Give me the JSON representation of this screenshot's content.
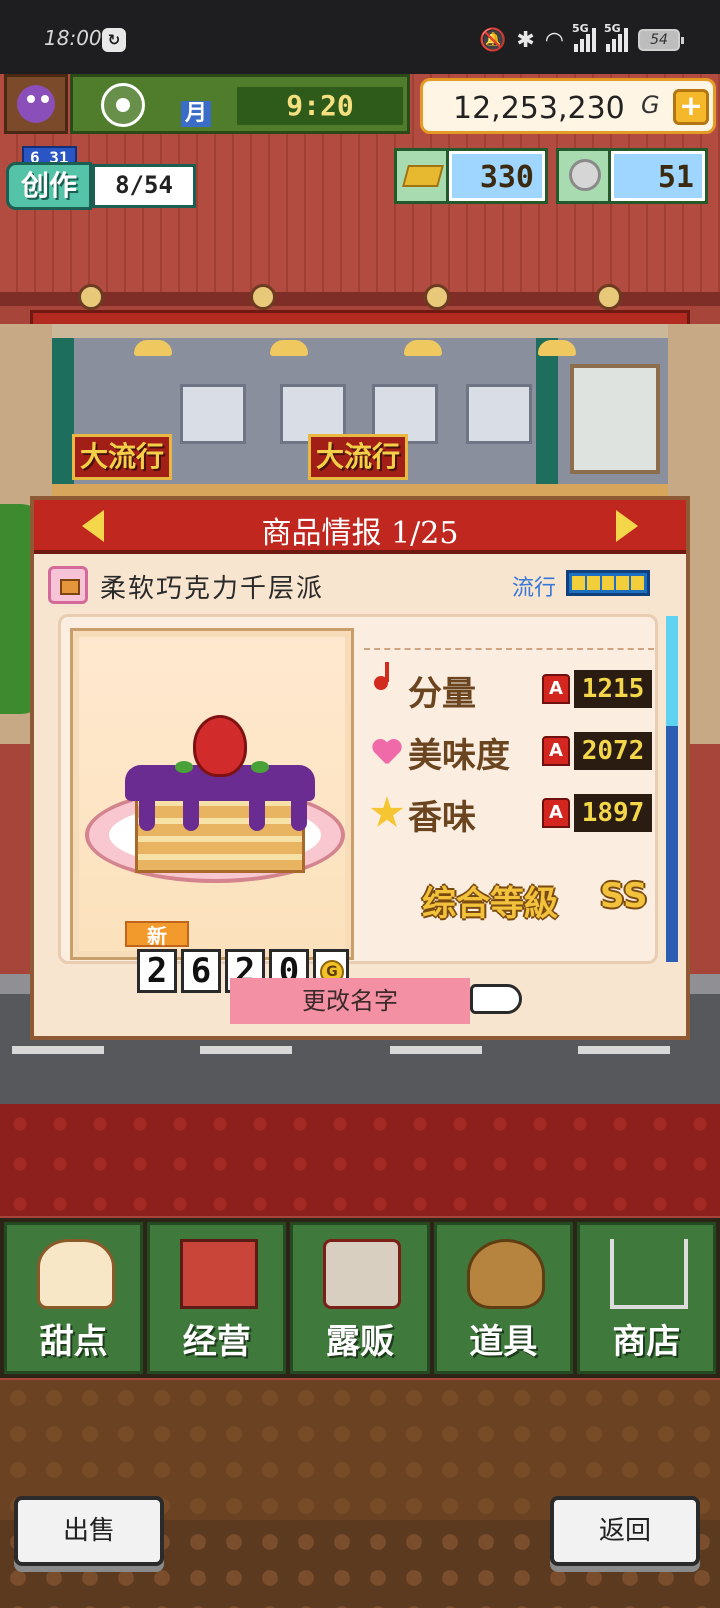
{
  "status_bar": {
    "time": "18:00",
    "battery": "54",
    "network_labels": [
      "5G",
      "5G"
    ]
  },
  "hud": {
    "month_label": "月",
    "time": "9:20",
    "gold_amount": "12,253,230",
    "gold_unit": "G",
    "plus_label": "+",
    "date": "6 31",
    "create_label": "创作",
    "create_count": "8/54",
    "resource_gold_bars": "330",
    "resource_medals": "51"
  },
  "shop": {
    "banner_left": "大流行",
    "banner_right": "大流行"
  },
  "dialog": {
    "title": "商品情报",
    "page": "1/25",
    "product_name": "柔软巧克力千层派",
    "trend_label": "流行",
    "trend_level": 5,
    "new_tag": "新",
    "price_digits": [
      "2",
      "6",
      "2",
      "0"
    ],
    "price_unit": "G",
    "stats": [
      {
        "icon": "music-note-icon",
        "label": "分量",
        "rank": "A",
        "value": "1215"
      },
      {
        "icon": "heart-icon",
        "label": "美味度",
        "rank": "A",
        "value": "2072"
      },
      {
        "icon": "star-icon",
        "label": "香味",
        "rank": "A",
        "value": "1897"
      }
    ],
    "overall_label": "综合等級",
    "overall_grade": "SS",
    "rename_label": "更改名字"
  },
  "menu": {
    "items": [
      {
        "label": "甜点",
        "icon": "cake-icon"
      },
      {
        "label": "经营",
        "icon": "shop-icon"
      },
      {
        "label": "露贩",
        "icon": "food-truck-icon"
      },
      {
        "label": "道具",
        "icon": "items-bag-icon"
      },
      {
        "label": "商店",
        "icon": "shopping-cart-icon"
      }
    ]
  },
  "footer": {
    "sell_label": "出售",
    "back_label": "返回"
  },
  "colors": {
    "header_red": "#c0271f",
    "menu_green": "#3f7a3c",
    "gold_text": "#f2c23c"
  }
}
